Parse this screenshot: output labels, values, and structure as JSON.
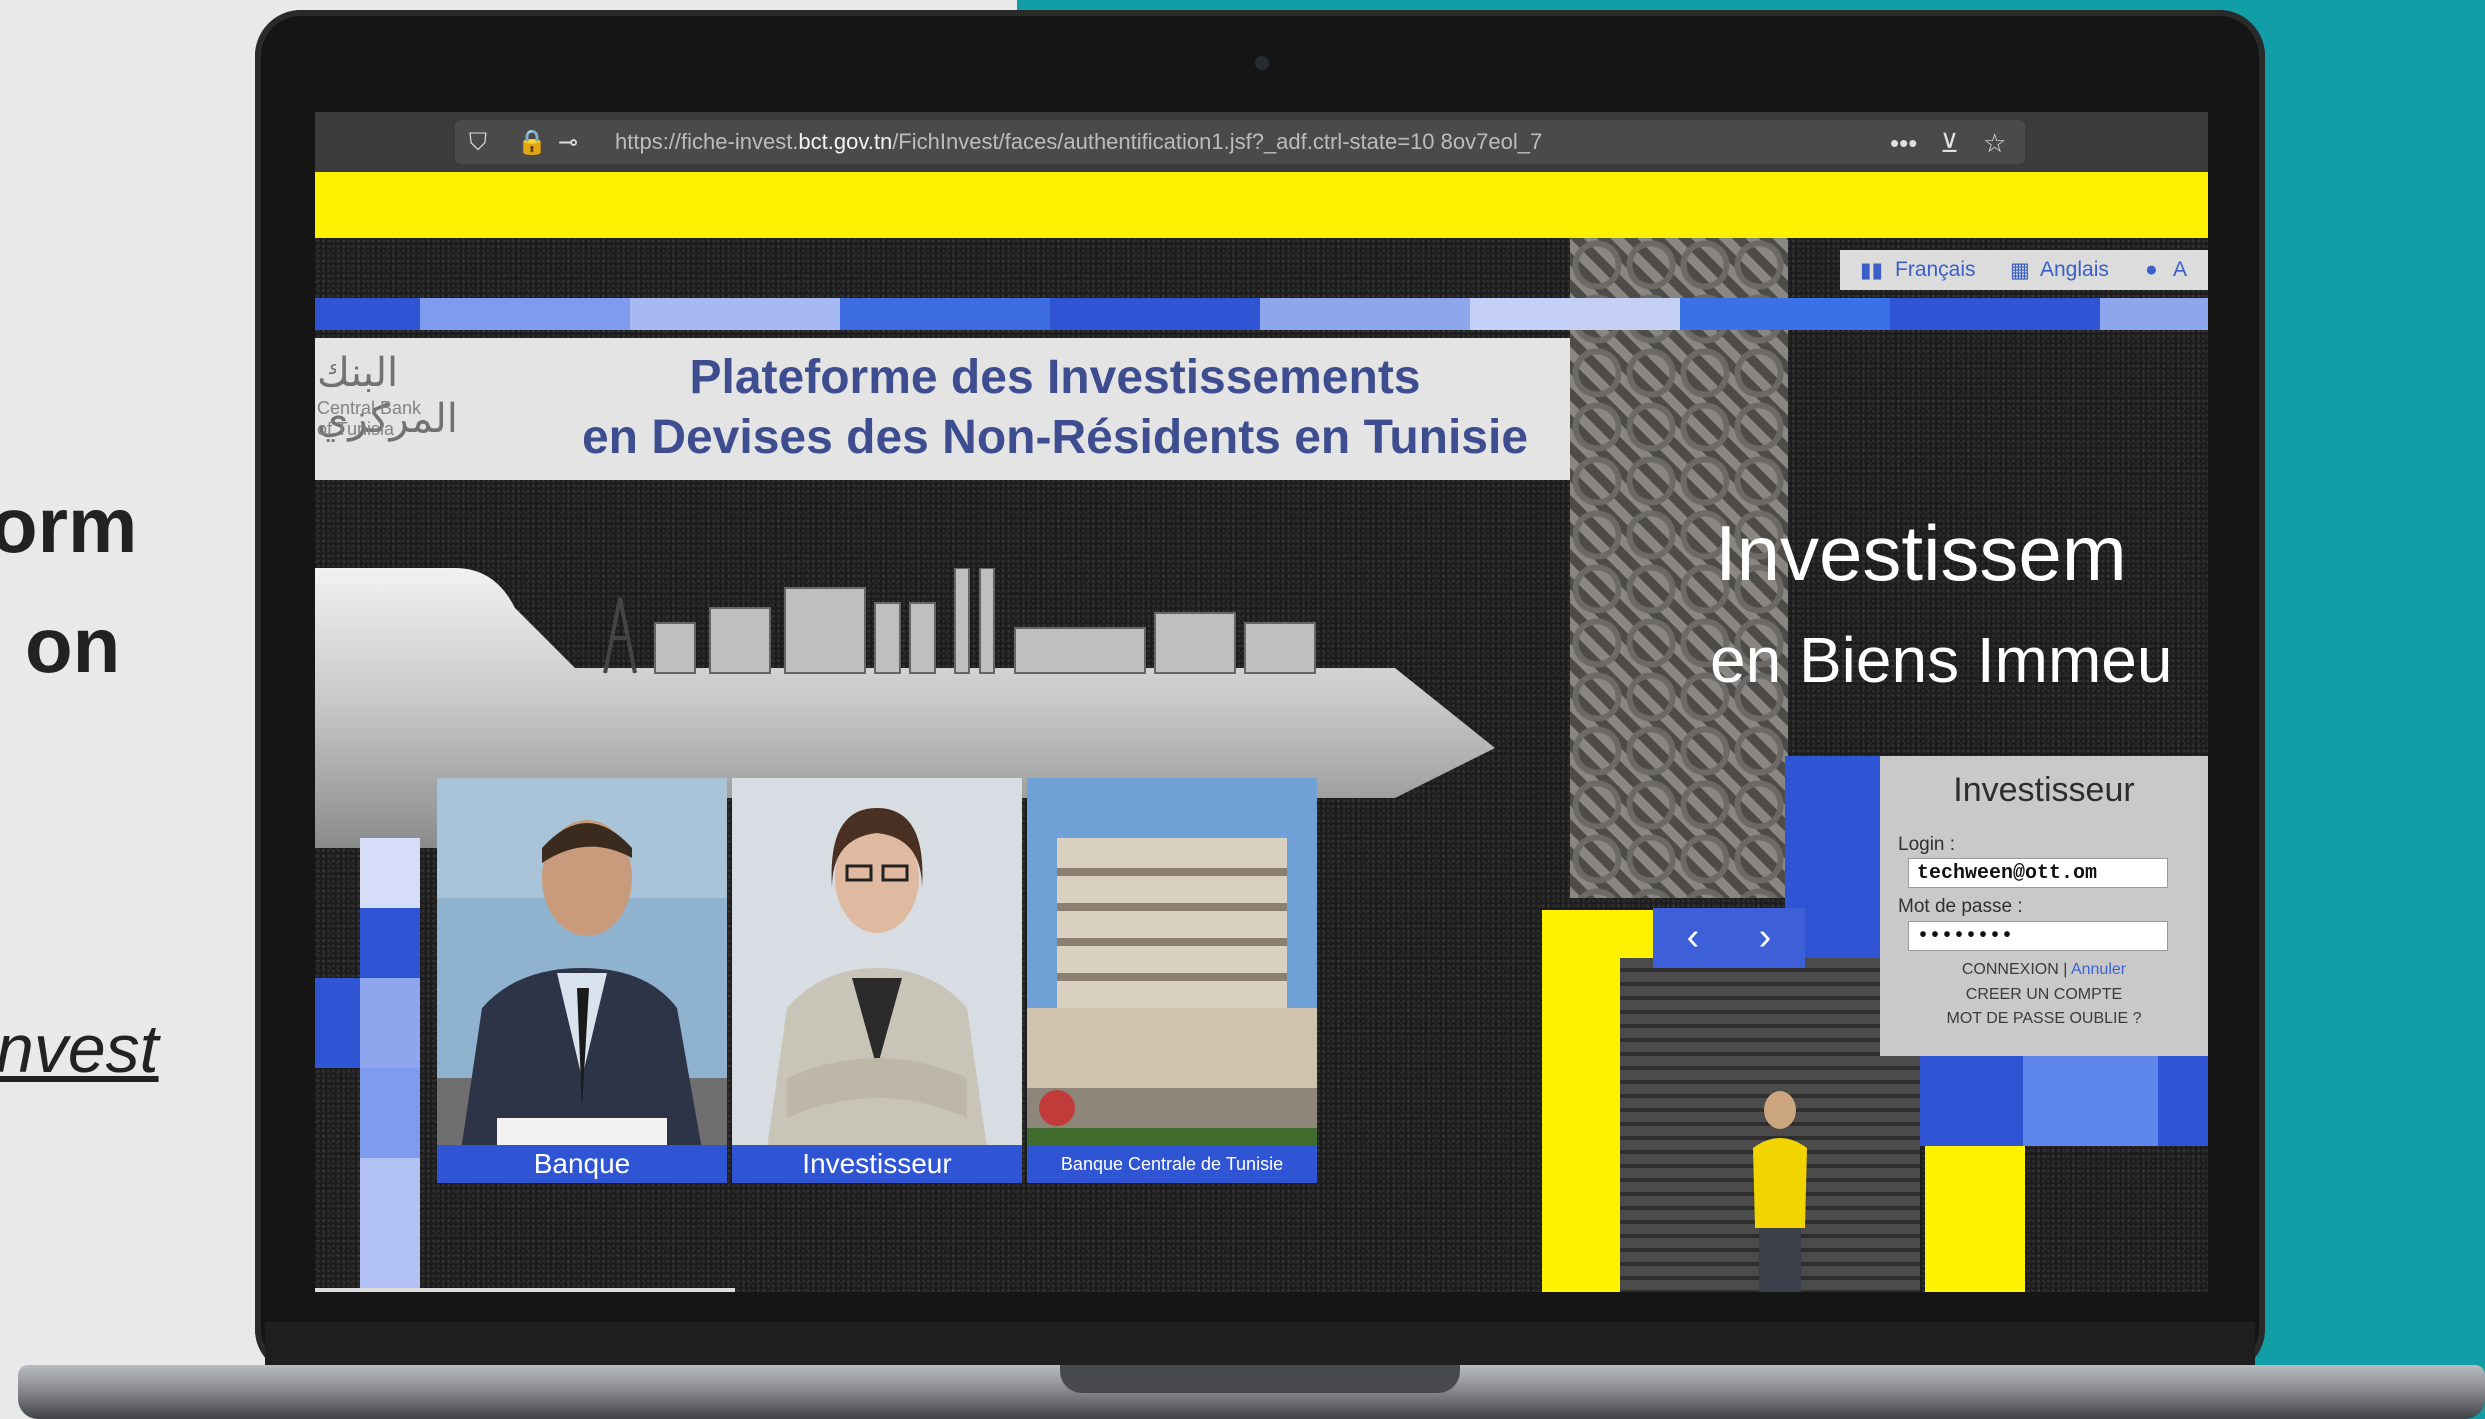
{
  "slide": {
    "side_text_line1": "orm",
    "side_text_line2": "on",
    "side_link": "nvest"
  },
  "browser": {
    "url_prefix": "https://fiche-invest.",
    "url_domain": "bct.gov.tn",
    "url_path": "/FichInvest/faces/authentification1.jsf?_adf.ctrl-state=10 8ov7eol_7",
    "menu_icon": "more-icon",
    "pocket_icon": "pocket-icon",
    "bookmark_icon": "star-icon"
  },
  "languages": {
    "fr": "Français",
    "en": "Anglais",
    "ar": "A"
  },
  "banner": {
    "logo_arabic": "البنك المركزي",
    "logo_sub1": "Central Bank",
    "logo_sub2": "of Tunisia",
    "title_line1": "Plateforme des Investissements",
    "title_line2": "en Devises des Non-Résidents en Tunisie"
  },
  "hero": {
    "line1": "Investissem",
    "line2": "en Biens Immeu"
  },
  "cards": [
    {
      "label": "Banque"
    },
    {
      "label": "Investisseur"
    },
    {
      "label": "Banque Centrale de Tunisie"
    }
  ],
  "login": {
    "title": "Investisseur",
    "login_label": "Login :",
    "login_value": "techween@ott.om",
    "password_label": "Mot de passe :",
    "password_value": "••••••••",
    "connexion": "CONNEXION",
    "separator": "|",
    "annuler": "Annuler",
    "create_account": "CREER UN COMPTE",
    "forgot_password": "MOT DE PASSE OUBLIE ?"
  },
  "carousel": {
    "prev": "‹",
    "next": "›"
  },
  "colors": {
    "teal": "#129ea6",
    "yellow": "#fff200",
    "blue": "#2f55d4",
    "title_blue": "#3d4d8f"
  }
}
